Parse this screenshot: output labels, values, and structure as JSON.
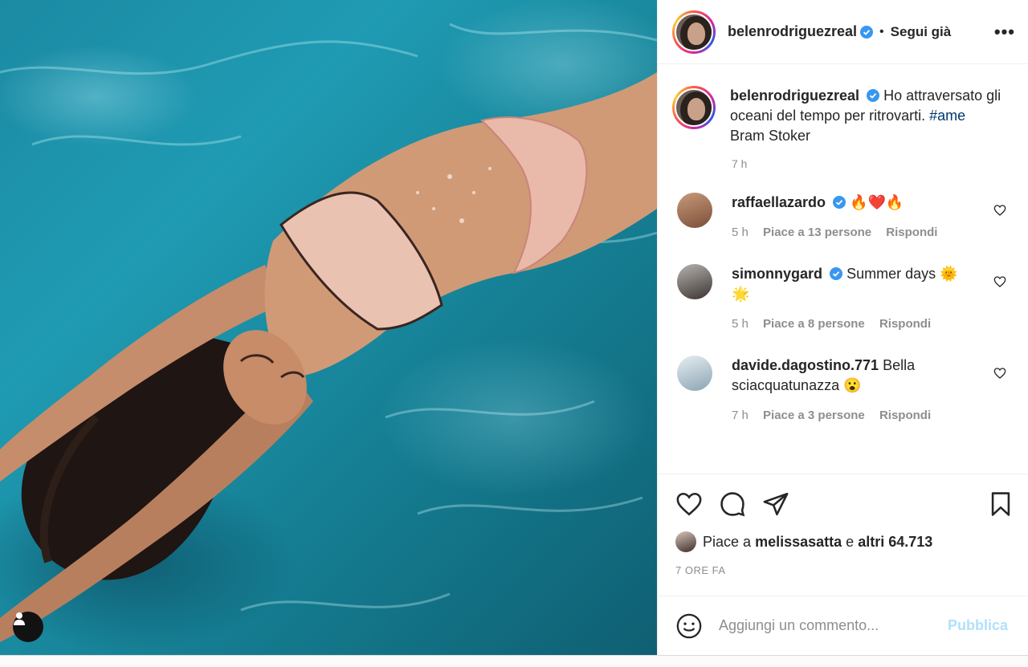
{
  "post": {
    "author": "belenrodriguezreal",
    "follow_label": "Segui già",
    "separator": "•",
    "more_label": "•••"
  },
  "caption": {
    "author": "belenrodriguezreal",
    "text": "Ho attraversato gli oceani del tempo per ritrovarti.",
    "hashtag": "#ame",
    "text_after": "Bram Stoker",
    "time": "7 h"
  },
  "comments": [
    {
      "user": "raffaellazardo",
      "verified": true,
      "text": "🔥❤️🔥",
      "time": "5 h",
      "likes": "Piace a 13 persone",
      "reply": "Rispondi"
    },
    {
      "user": "simonnygard",
      "verified": true,
      "text": "Summer days 🌞🌟",
      "time": "5 h",
      "likes": "Piace a 8 persone",
      "reply": "Rispondi"
    },
    {
      "user": "davide.dagostino.771",
      "verified": false,
      "text": "Bella sciacquatunazza 😮",
      "time": "7 h",
      "likes": "Piace a 3 persone",
      "reply": "Rispondi"
    }
  ],
  "likes": {
    "prefix": "Piace a",
    "user": "melissasatta",
    "conj": "e",
    "others": "altri 64.713"
  },
  "timeago": "7 ORE FA",
  "add_comment": {
    "placeholder": "Aggiungi un commento...",
    "publish_label": "Pubblica"
  },
  "colors": {
    "verified": "#3897f0",
    "hashtag": "#00376b",
    "publish": "#b2dffc",
    "meta": "#8e8e8e"
  },
  "icons": [
    "heart-icon",
    "comment-icon",
    "share-icon",
    "bookmark-icon",
    "emoji-icon",
    "user-icon",
    "verified-icon"
  ]
}
